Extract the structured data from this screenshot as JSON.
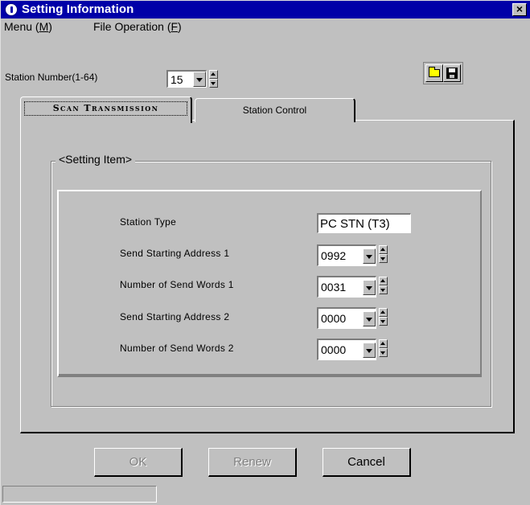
{
  "window": {
    "title": "Setting Information",
    "close_label": "×"
  },
  "menu": {
    "items": [
      {
        "label": "Menu (",
        "mnemonic": "M",
        "suffix": ")"
      },
      {
        "label": "File Operation (",
        "mnemonic": "F",
        "suffix": ")"
      }
    ]
  },
  "station": {
    "label": "Station Number(1-64)",
    "value": "15"
  },
  "toolbar": {
    "open_icon": "folder-open-icon",
    "save_icon": "floppy-disk-icon",
    "accent_yellow": "#ffff00"
  },
  "tabs": [
    {
      "label": "Scan Transmission",
      "active": true
    },
    {
      "label": "Station Control",
      "active": false
    }
  ],
  "group": {
    "title": "<Setting Item>"
  },
  "fields": {
    "station_type": {
      "label": "Station Type",
      "value": "PC STN (T3)"
    },
    "send_start_1": {
      "label": "Send Starting Address 1",
      "value": "0992"
    },
    "send_words_1": {
      "label": "Number of Send Words 1",
      "value": "0031"
    },
    "send_start_2": {
      "label": "Send Starting Address 2",
      "value": "0000"
    },
    "send_words_2": {
      "label": "Number of Send Words 2",
      "value": "0000"
    }
  },
  "buttons": {
    "ok": "OK",
    "renew": "Renew",
    "cancel": "Cancel"
  },
  "colors": {
    "titlebar": "#0000a8",
    "face": "#c0c0c0"
  }
}
